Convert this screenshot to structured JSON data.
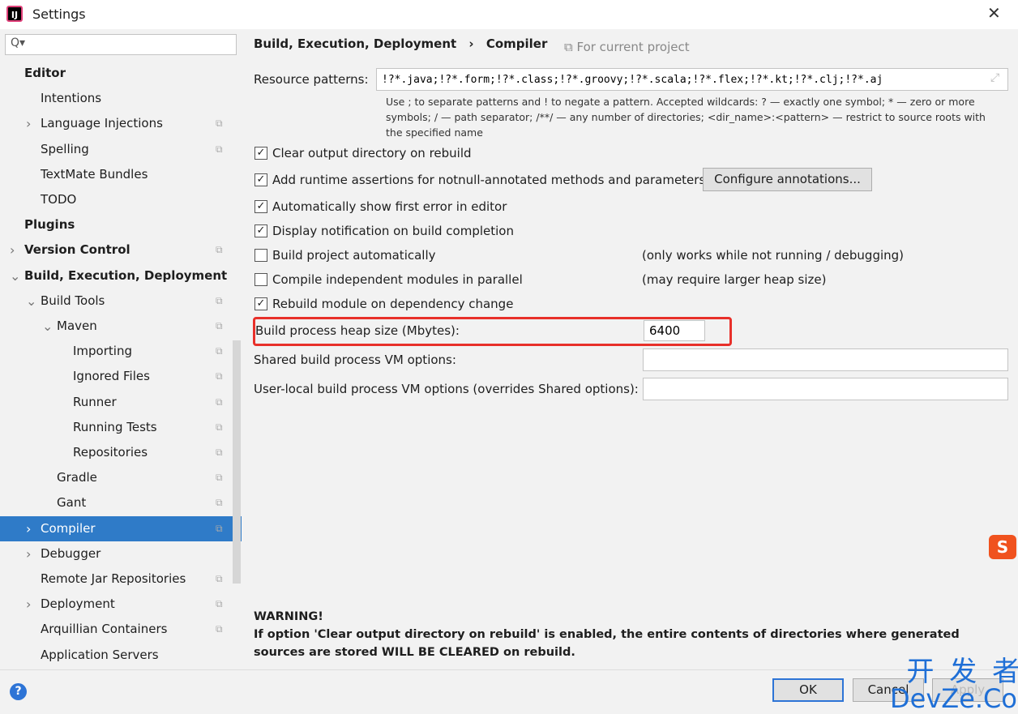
{
  "window": {
    "title": "Settings",
    "close": "✕"
  },
  "search": {
    "placeholder": "Q▾"
  },
  "tree": [
    {
      "label": "Editor",
      "level": 0,
      "bold": true
    },
    {
      "label": "Intentions",
      "level": 1
    },
    {
      "label": "Language Injections",
      "level": 1,
      "arrow": "›",
      "copy": true
    },
    {
      "label": "Spelling",
      "level": 1,
      "copy": true
    },
    {
      "label": "TextMate Bundles",
      "level": 1
    },
    {
      "label": "TODO",
      "level": 1
    },
    {
      "label": "Plugins",
      "level": 0,
      "bold": true
    },
    {
      "label": "Version Control",
      "level": 0,
      "bold": true,
      "arrow": "›",
      "copy": true
    },
    {
      "label": "Build, Execution, Deployment",
      "level": 0,
      "bold": true,
      "arrow": "⌄"
    },
    {
      "label": "Build Tools",
      "level": 1,
      "arrow": "⌄",
      "copy": true
    },
    {
      "label": "Maven",
      "level": 2,
      "arrow": "⌄",
      "copy": true
    },
    {
      "label": "Importing",
      "level": 3,
      "copy": true
    },
    {
      "label": "Ignored Files",
      "level": 3,
      "copy": true
    },
    {
      "label": "Runner",
      "level": 3,
      "copy": true
    },
    {
      "label": "Running Tests",
      "level": 3,
      "copy": true
    },
    {
      "label": "Repositories",
      "level": 3,
      "copy": true
    },
    {
      "label": "Gradle",
      "level": 2,
      "copy": true
    },
    {
      "label": "Gant",
      "level": 2,
      "copy": true
    },
    {
      "label": "Compiler",
      "level": 1,
      "arrow": "›",
      "copy": true,
      "selected": true
    },
    {
      "label": "Debugger",
      "level": 1,
      "arrow": "›"
    },
    {
      "label": "Remote Jar Repositories",
      "level": 1,
      "copy": true
    },
    {
      "label": "Deployment",
      "level": 1,
      "arrow": "›",
      "copy": true
    },
    {
      "label": "Arquillian Containers",
      "level": 1,
      "copy": true
    },
    {
      "label": "Application Servers",
      "level": 1
    }
  ],
  "breadcrumb": {
    "parent": "Build, Execution, Deployment",
    "sep": "›",
    "current": "Compiler"
  },
  "for_project": "⧉ For current project",
  "resource": {
    "label": "Resource patterns:",
    "value": "!?*.java;!?*.form;!?*.class;!?*.groovy;!?*.scala;!?*.flex;!?*.kt;!?*.clj;!?*.aj",
    "help": "Use ; to separate patterns and ! to negate a pattern. Accepted wildcards: ? — exactly one symbol; * — zero or more symbols; / — path separator; /**/ — any number of directories; <dir_name>:<pattern> — restrict to source roots with the specified name"
  },
  "options": [
    {
      "label": "Clear output directory on rebuild",
      "checked": true
    },
    {
      "label": "Add runtime assertions for notnull-annotated methods and parameters",
      "checked": true
    },
    {
      "label": "Automatically show first error in editor",
      "checked": true
    },
    {
      "label": "Display notification on build completion",
      "checked": true
    },
    {
      "label": "Build project automatically",
      "checked": false,
      "note": "(only works while not running / debugging)"
    },
    {
      "label": "Compile independent modules in parallel",
      "checked": false,
      "note": "(may require larger heap size)"
    },
    {
      "label": "Rebuild module on dependency change",
      "checked": true
    }
  ],
  "configure_annotations": "Configure annotations...",
  "heap": {
    "label": "Build process heap size (Mbytes):",
    "value": "6400",
    "highlight_color": "#e8302a"
  },
  "shared_vm": {
    "label": "Shared build process VM options:",
    "value": ""
  },
  "user_vm": {
    "label": "User-local build process VM options (overrides Shared options):",
    "value": ""
  },
  "warning": {
    "title": "WARNING!",
    "text": "If option 'Clear output directory on rebuild' is enabled, the entire contents of directories where generated sources are stored WILL BE CLEARED on rebuild."
  },
  "footer": {
    "ok": "OK",
    "cancel": "Cancel",
    "apply": "Apply",
    "help": "?"
  },
  "watermark": {
    "line1": "开 发 者",
    "line2": "DevZe.CoM"
  },
  "accent": "#2f7bc8"
}
